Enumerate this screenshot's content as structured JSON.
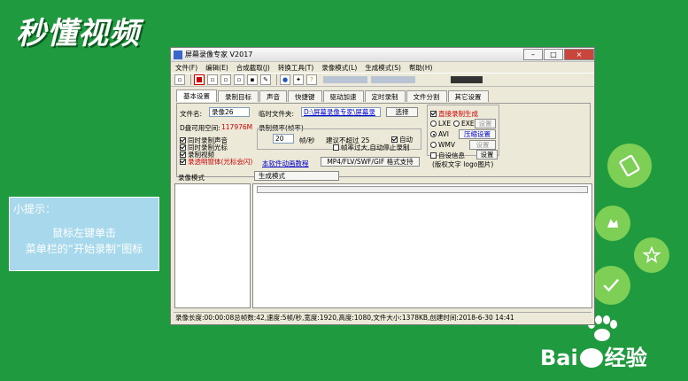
{
  "overlay": {
    "brand": "秒懂视频",
    "tip_title": "小提示：",
    "tip_line1": "鼠标左键单击",
    "tip_line2": "菜单栏的“开始录制”图标",
    "baidu": "Bai",
    "baidu_tail": "经验"
  },
  "window": {
    "title": "屏幕录像专家 V2017",
    "min": "–",
    "max": "□",
    "close": "×"
  },
  "menu": [
    "文件(F)",
    "编辑(E)",
    "合成截取(J)",
    "转换工具(T)",
    "录像模式(L)",
    "生成模式(S)",
    "帮助(H)"
  ],
  "tabs": [
    "基本设置",
    "录制目标",
    "声音",
    "快捷键",
    "驱动加速",
    "定时录制",
    "文件分割",
    "其它设置"
  ],
  "basic": {
    "filename_label": "文件名:",
    "filename_value": "录像26",
    "disk_label": "D盘可用空间:",
    "disk_value": "117976M",
    "temp_label": "临时文件夹:",
    "temp_value": "D:\\屏幕录像专家\\屏幕录",
    "choose_btn": "选择",
    "freq_title": "录制频率(帧率)",
    "fps_value": "20",
    "fps_unit": "帧/秒",
    "suggest": "建议不超过  25",
    "auto": "自动",
    "stop_note": "帧率过大,自动停止录制",
    "cb_sound": "同时录制声音",
    "cb_cursor": "同时录制光标",
    "cb_video": "录制视频",
    "cb_transparent": "录透明窗体(光标会闪)",
    "tutorial_link": "本软件动画教程",
    "format_btn": "MP4/FLV/SWF/GIF  格式支持",
    "direct_gen": "直接录制生成",
    "lxe": "LXE",
    "exe": "EXE",
    "apply_btn": "设置",
    "avi": "AVI",
    "compress_btn": "压缩设置",
    "wmv": "WMV",
    "set_btn2": "设置",
    "custom_info": "自设信息",
    "set_btn3": "设置",
    "copyright": "(版权文字 logo图片)"
  },
  "lower": {
    "left_title": "录像模式",
    "right_title": "生成模式"
  },
  "status": "录像长度:00:00:08总帧数:42,速度:5帧/秒,宽度:1920,高度:1080,文件大小:1378KB,创建时间:2018-6-30 14:41",
  "colors": {
    "background": "#1f9a3e",
    "tip_box": "#a8d8ec",
    "accent_red": "#cc0000",
    "link_blue": "#0000cc"
  }
}
